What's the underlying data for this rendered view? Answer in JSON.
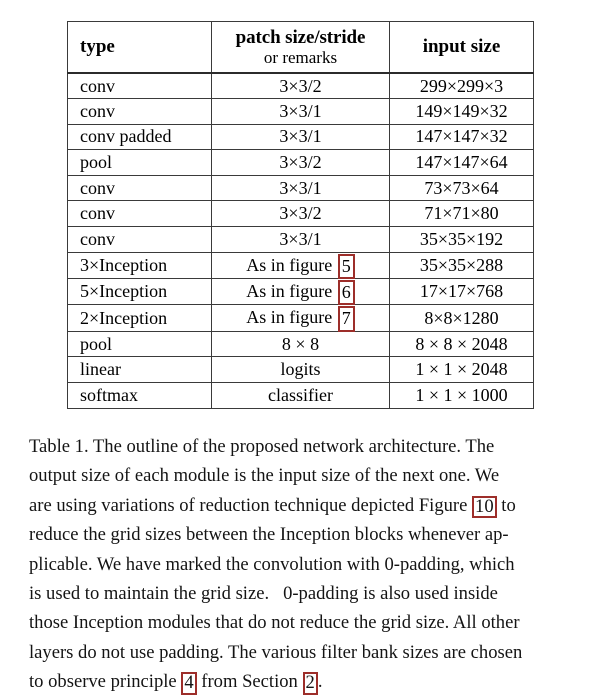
{
  "document": {
    "kind": "academic-paper-table-figure",
    "accent_color": "#9d2e2a",
    "text_color": "#141414",
    "background_color": "#ffffff"
  },
  "table": {
    "headers": {
      "type": "type",
      "patch_line1": "patch size/stride",
      "patch_line2": "or remarks",
      "input": "input size"
    },
    "rows": [
      {
        "type": "conv",
        "patch": "3×3/2",
        "patch_ref": "",
        "input": "299×299×3"
      },
      {
        "type": "conv",
        "patch": "3×3/1",
        "patch_ref": "",
        "input": "149×149×32"
      },
      {
        "type": "conv padded",
        "patch": "3×3/1",
        "patch_ref": "",
        "input": "147×147×32"
      },
      {
        "type": "pool",
        "patch": "3×3/2",
        "patch_ref": "",
        "input": "147×147×64"
      },
      {
        "type": "conv",
        "patch": "3×3/1",
        "patch_ref": "",
        "input": "73×73×64"
      },
      {
        "type": "conv",
        "patch": "3×3/2",
        "patch_ref": "",
        "input": "71×71×80"
      },
      {
        "type": "conv",
        "patch": "3×3/1",
        "patch_ref": "",
        "input": "35×35×192"
      },
      {
        "type": "3×Inception",
        "patch": "As in figure",
        "patch_ref": "5",
        "input": "35×35×288"
      },
      {
        "type": "5×Inception",
        "patch": "As in figure",
        "patch_ref": "6",
        "input": "17×17×768"
      },
      {
        "type": "2×Inception",
        "patch": "As in figure",
        "patch_ref": "7",
        "input": "8×8×1280"
      },
      {
        "type": "pool",
        "patch": "8 × 8",
        "patch_ref": "",
        "input": "8 × 8 × 2048"
      },
      {
        "type": "linear",
        "patch": "logits",
        "patch_ref": "",
        "input": "1 × 1 × 2048"
      },
      {
        "type": "softmax",
        "patch": "classifier",
        "patch_ref": "",
        "input": "1 × 1 × 1000"
      }
    ]
  },
  "caption": {
    "full_text": "Table 1. The outline of the proposed network architecture. The output size of each module is the input size of the next one. We are using variations of reduction technique depicted Figure 10 to reduce the grid sizes between the Inception blocks whenever applicable. We have marked the convolution with 0-padding, which is used to maintain the grid size. 0-padding is also used inside those Inception modules that do not reduce the grid size. All other layers do not use padding. The various filter bank sizes are chosen to observe principle 4 from Section 2.",
    "lines": [
      {
        "pre": "Table 1. The outline of the proposed network architecture.",
        "ref": "",
        "post": "The"
      },
      {
        "pre": "output size of each module is the input size of the next one.",
        "ref": "",
        "post": "We"
      },
      {
        "pre": "are using variations of reduction technique depicted Figure",
        "ref": "10",
        "post": "to"
      },
      {
        "pre": "reduce the grid sizes between the Inception blocks whenever ap-",
        "ref": "",
        "post": ""
      },
      {
        "pre": "plicable. We have marked the convolution with 0-padding, which",
        "ref": "",
        "post": ""
      },
      {
        "pre": "is used to maintain the grid size.   0-padding is also used inside",
        "ref": "",
        "post": ""
      },
      {
        "pre": "those Inception modules that do not reduce the grid size. All other",
        "ref": "",
        "post": ""
      },
      {
        "pre": "layers do not use padding. The various filter bank sizes are chosen",
        "ref": "",
        "post": ""
      }
    ],
    "last_line": {
      "pre": "to observe principle",
      "ref1": "4",
      "mid": "from Section",
      "ref2": "2",
      "post": "."
    }
  }
}
